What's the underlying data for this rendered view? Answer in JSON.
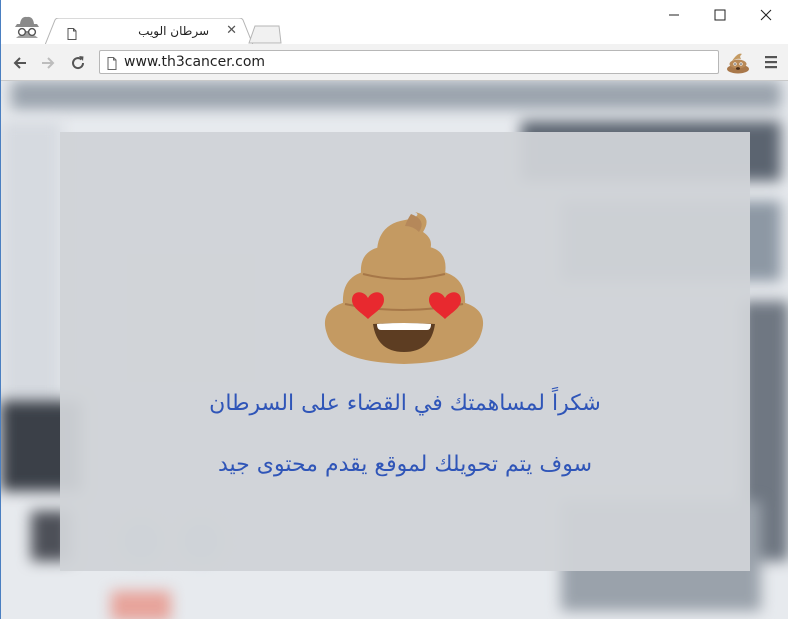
{
  "browser": {
    "tab_title": "سرطان الويب",
    "tab_close": "✕",
    "url": "www.th3cancer.com",
    "icons": {
      "incognito": "incognito-icon",
      "favicon": "page-icon",
      "back": "back-arrow-icon",
      "forward": "forward-arrow-icon",
      "reload": "reload-icon",
      "extension": "poop-emoji-icon",
      "menu": "hamburger-menu-icon"
    }
  },
  "message": {
    "line1": "شكراً لمساهمتك في القضاء على السرطان",
    "line2": "سوف يتم تحويلك لموقع يقدم محتوى جيد"
  },
  "colors": {
    "message_text": "#2f55b8",
    "overlay": "#d0d3d7",
    "poop": "#c49a62",
    "heart": "#e8292f"
  }
}
